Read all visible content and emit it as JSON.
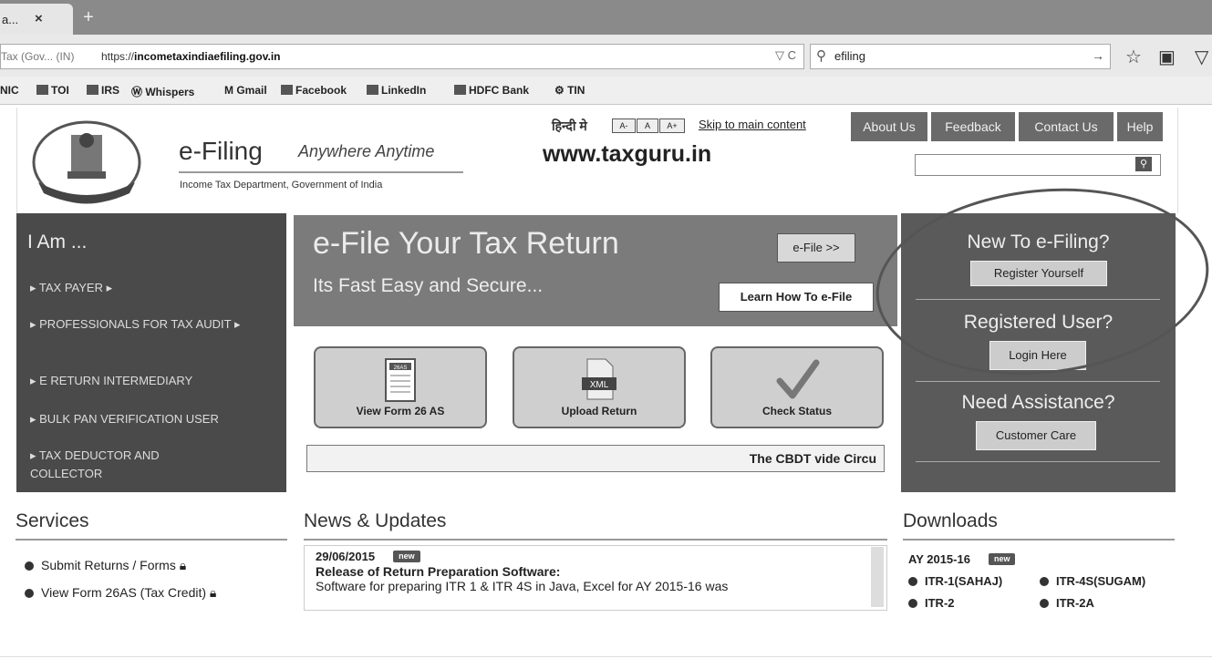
{
  "browser": {
    "tab_title": "...",
    "tab_title_prefix": "a",
    "new_tab": "+",
    "site_label": "Tax (Gov... (IN)",
    "url_prefix": "https://",
    "url_host": "incometaxindiaefiling.gov.in",
    "url_controls": "▽ C",
    "search_value": "efiling",
    "search_go": "→",
    "bookmarks": [
      "NIC",
      "TOI",
      "IRS",
      "Whispers",
      "Gmail",
      "Facebook",
      "LinkedIn",
      "HDFC Bank",
      "TIN"
    ]
  },
  "header": {
    "title": "e-Filing",
    "tagline": "Anywhere Anytime",
    "subtitle": "Income Tax Department, Government of India",
    "hindi_link": "हिन्दी मे",
    "font_sizes": [
      "A-",
      "A",
      "A+"
    ],
    "skip_link": "Skip to main content",
    "watermark": "www.taxguru.in",
    "nav": [
      "About Us",
      "Feedback",
      "Contact Us",
      "Help"
    ]
  },
  "iam": {
    "heading": "I Am ...",
    "items": [
      "▸ TAX PAYER ▸",
      "▸ PROFESSIONALS FOR TAX AUDIT ▸",
      "▸ E RETURN INTERMEDIARY",
      "▸ BULK PAN VERIFICATION USER",
      "▸ TAX DEDUCTOR AND COLLECTOR"
    ]
  },
  "banner": {
    "title": "e-File Your Tax Return",
    "subtitle": "Its Fast Easy and Secure...",
    "efile_button": "e-File >>",
    "learn_button": "Learn How To e-File"
  },
  "tiles": [
    {
      "label": "View Form 26 AS",
      "icon": "form-26as-icon",
      "icon_text": "26AS"
    },
    {
      "label": "Upload Return",
      "icon": "xml-upload-icon",
      "icon_text": "XML"
    },
    {
      "label": "Check Status",
      "icon": "checkmark-icon"
    }
  ],
  "ticker": "The CBDT vide Circu",
  "right_panel": {
    "new_heading": "New To e-Filing?",
    "register_button": "Register Yourself",
    "registered_heading": "Registered User?",
    "login_button": "Login Here",
    "assist_heading": "Need Assistance?",
    "care_button": "Customer Care"
  },
  "services": {
    "heading": "Services",
    "items": [
      "Submit Returns / Forms",
      "View Form 26AS (Tax Credit)"
    ]
  },
  "news": {
    "heading": "News & Updates",
    "date": "29/06/2015",
    "badge": "new",
    "headline": "Release of Return Preparation Software:",
    "body": "Software for preparing ITR 1 & ITR 4S in Java, Excel for AY 2015-16 was"
  },
  "downloads": {
    "heading": "Downloads",
    "year": "AY 2015-16",
    "badge": "new",
    "items": [
      "ITR-1(SAHAJ)",
      "ITR-4S(SUGAM)",
      "ITR-2",
      "ITR-2A"
    ]
  },
  "colors": {
    "accent_dark": "#4a4a4a",
    "banner": "#7b7b7b",
    "panel": "#5a5a5a"
  }
}
